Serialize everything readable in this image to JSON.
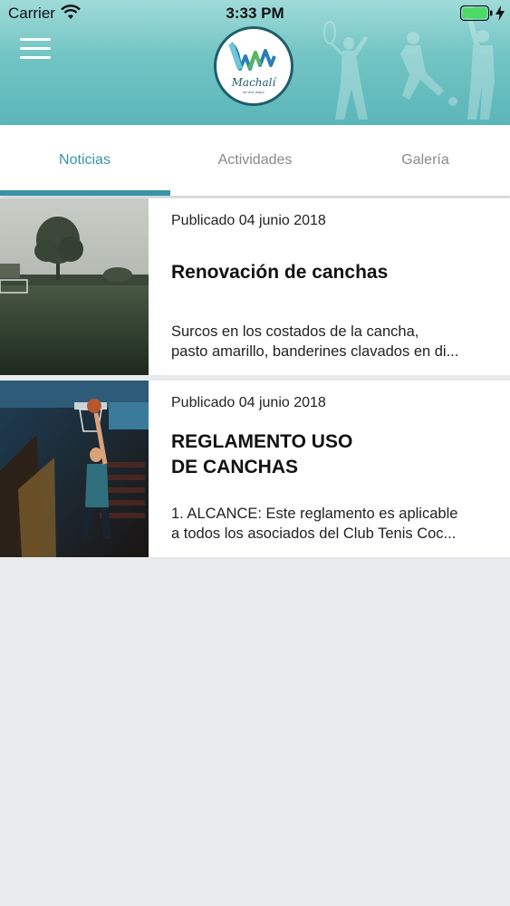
{
  "status_bar": {
    "carrier": "Carrier",
    "time": "3:33 PM"
  },
  "header": {
    "logo_text": "Machalí",
    "logo_subtext": "se vive mejor"
  },
  "tabs": [
    {
      "label": "Noticias",
      "active": true
    },
    {
      "label": "Actividades",
      "active": false
    },
    {
      "label": "Galería",
      "active": false
    }
  ],
  "news": [
    {
      "date": "Publicado 04 junio 2018",
      "title": "Renovación de canchas",
      "excerpt_line1": "Surcos en los costados de la cancha,",
      "excerpt_line2": "pasto amarillo, banderines clavados en di...",
      "image": "soccer-field-photo"
    },
    {
      "date": "Publicado 04 junio 2018",
      "title_line1": "REGLAMENTO USO",
      "title_line2": "DE CANCHAS",
      "excerpt_line1": "1. ALCANCE: Este reglamento es aplicable",
      "excerpt_line2": "a todos los asociados del Club Tenis Coc...",
      "image": "basketball-court-photo"
    }
  ],
  "colors": {
    "accent": "#3b93a8",
    "header_teal": "#6cc1c1",
    "background": "#e9eaee"
  }
}
